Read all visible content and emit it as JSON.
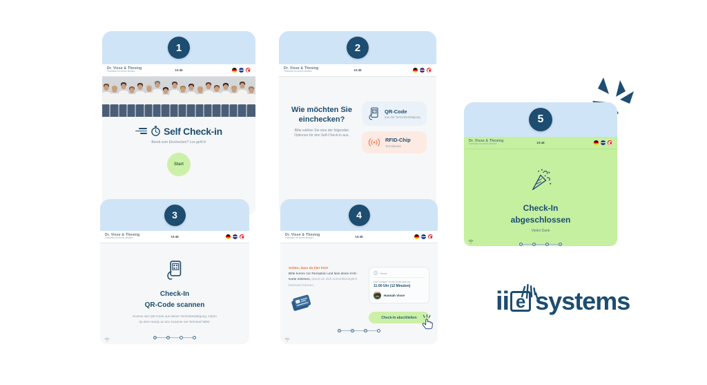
{
  "meta": {
    "terminal_brand": "Dr. Visse & Thesing",
    "terminal_brand_sub": "Fachärzte für Innere Medizin",
    "clock": "10:48",
    "languages": [
      "flag-de",
      "flag-gb",
      "flag-tr"
    ],
    "wifi_icon": "wifi-icon",
    "colors": {
      "band": "#cfe4f7",
      "badge": "#1d4d70",
      "navy": "#1d4d70",
      "green_screen": "#c4f0a0",
      "green_button": "#cdf0a8",
      "orange": "#f06a3c",
      "peach_card": "#fdeae3",
      "blue_card": "#eaf1f8",
      "body_bg": "#f6f7f8"
    }
  },
  "screens": [
    {
      "number": "1",
      "name": "self-check-in-welcome",
      "photo_alt": "team-photo",
      "title": "Self Check-in",
      "subtitle": "Bereit zum Einchecken? Los geht's!",
      "button": "Start",
      "icons": {
        "logo": "stopwatch-icon"
      }
    },
    {
      "number": "2",
      "name": "check-in-method-selection",
      "heading": "Wie möchten Sie einchecken?",
      "subtext": "Bitte wählen Sie eine der folgenden Optionen für den Self-Check-in aus.",
      "options": [
        {
          "title": "QR-Code",
          "sub": "aus der Terminbestätigung",
          "icon": "qr-phone-icon"
        },
        {
          "title": "RFID-Chip",
          "sub": "Terminkarte",
          "icon": "rfid-waves-icon"
        }
      ]
    },
    {
      "number": "3",
      "name": "qr-scan-instruction",
      "icon": "qr-phone-icon",
      "title_line1": "Check-In",
      "title_line2": "QR-Code scannen",
      "body": "Scanne den QR-Code aus deiner Terminbestätigung, indem du dein Handy an den Scanner am Terminal hältst.",
      "progress": {
        "total": 4,
        "filled": 2
      }
    },
    {
      "number": "4",
      "name": "reception-instruction",
      "highlight": "Schön, dass du hier bist!",
      "body_strong": "Bitte komm zur Rezeption und lass deine KVK-Karte einlesen,",
      "body_dim": " damit wir dich schnellstmöglich betreuen können.",
      "card_icon": "insurance-card-icon",
      "appointment": {
        "header": "Heute",
        "header_icon": "clock-icon",
        "label": "Dein heutiger Termin findet statt um:",
        "time": "11:00 Uhr (12 Minuten)",
        "person": "Hannah Visse",
        "avatar": "avatar"
      },
      "button": "Check-In abschließen",
      "cursor_icon": "hand-cursor-icon",
      "progress": {
        "total": 4,
        "filled": 3
      }
    },
    {
      "number": "5",
      "name": "check-in-complete",
      "icon": "confetti-icon",
      "title_line1": "Check-In",
      "title_line2": "abgeschlossen",
      "subtitle": "Vielen Dank",
      "progress": {
        "total": 4,
        "filled": 4
      }
    }
  ],
  "logo": {
    "prefix": "ii",
    "boxed_letter": "e",
    "word": "systems",
    "rays_icon": "sparkle-rays-icon"
  }
}
